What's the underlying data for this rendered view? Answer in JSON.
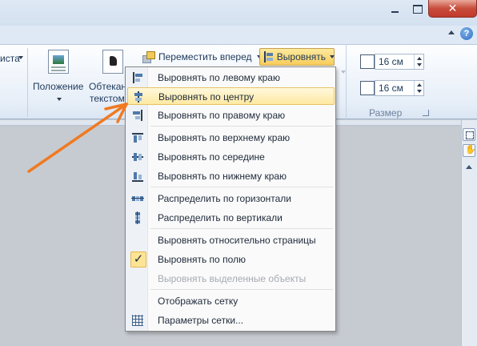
{
  "ribbon": {
    "fragment_left": "иста",
    "position_label": "Положение",
    "wrap_label_line1": "Обтекан",
    "wrap_label_line2": "текстом",
    "bring_forward_label": "Переместить вперед",
    "align_label": "Выровнять",
    "height_value": "16 см",
    "width_value": "16 см",
    "size_group_label": "Размер"
  },
  "window": {
    "close_glyph": "✕",
    "help_glyph": "?"
  },
  "menu": {
    "items": [
      {
        "label": "Выровнять по левому краю",
        "icon": "align-left-icon"
      },
      {
        "label": "Выровнять по центру",
        "icon": "align-center-icon",
        "state": "hover"
      },
      {
        "label": "Выровнять по правому краю",
        "icon": "align-right-icon"
      },
      {
        "label": "Выровнять по верхнему краю",
        "icon": "align-top-icon"
      },
      {
        "label": "Выровнять по середине",
        "icon": "align-middle-icon"
      },
      {
        "label": "Выровнять по нижнему краю",
        "icon": "align-bottom-icon"
      },
      {
        "label": "Распределить по горизонтали",
        "icon": "distribute-horizontal-icon"
      },
      {
        "label": "Распределить по вертикали",
        "icon": "distribute-vertical-icon"
      },
      {
        "label": "Выровнять относительно страницы"
      },
      {
        "label": "Выровнять по полю",
        "checked": true,
        "check_glyph": "✓"
      },
      {
        "label": "Выровнять выделенные объекты",
        "disabled": true
      },
      {
        "label": "Отображать сетку"
      },
      {
        "label": "Параметры сетки...",
        "icon": "grid-icon"
      }
    ]
  },
  "colors": {
    "hover_fill": "#fee9a2",
    "arrow": "#f07a22",
    "close_button": "#c74c3c"
  }
}
